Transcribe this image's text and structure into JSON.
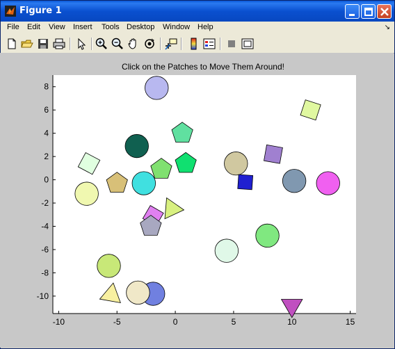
{
  "window": {
    "title": "Figure 1"
  },
  "menu": {
    "items": [
      "File",
      "Edit",
      "View",
      "Insert",
      "Tools",
      "Desktop",
      "Window",
      "Help"
    ]
  },
  "toolbar": {
    "tools": [
      "new-file",
      "open-file",
      "save",
      "print",
      "select-arrow",
      "zoom-in",
      "zoom-out",
      "pan",
      "rotate-3d",
      "data-cursor",
      "insert-colorbar",
      "insert-legend",
      "hide-plot-tools",
      "show-plot-tools"
    ]
  },
  "plot": {
    "title": "Click on the Patches to Move Them Around!"
  },
  "chart_data": {
    "type": "scatter",
    "title": "Click on the Patches to Move Them Around!",
    "xlim": [
      -10.5,
      15.5
    ],
    "ylim": [
      -11.5,
      9
    ],
    "xticks": [
      -10,
      -5,
      0,
      5,
      10,
      15
    ],
    "yticks": [
      -10,
      -8,
      -6,
      -4,
      -2,
      0,
      2,
      4,
      6,
      8
    ],
    "grid": false,
    "patches": [
      {
        "shape": "circle",
        "x": -1.6,
        "y": 7.9,
        "r": 1.0,
        "color": "#b8b8f0"
      },
      {
        "shape": "square",
        "x": 11.6,
        "y": 6.0,
        "r": 0.85,
        "angle": 18,
        "color": "#e0f8a0"
      },
      {
        "shape": "pentagon",
        "x": 0.6,
        "y": 4.0,
        "r": 0.95,
        "color": "#60e0a0"
      },
      {
        "shape": "circle",
        "x": -3.3,
        "y": 2.9,
        "r": 1.0,
        "color": "#106050"
      },
      {
        "shape": "square",
        "x": 8.4,
        "y": 2.2,
        "r": 0.85,
        "angle": 10,
        "color": "#a080d0"
      },
      {
        "shape": "square",
        "x": -7.4,
        "y": 1.4,
        "r": 0.85,
        "angle": 28,
        "color": "#e0ffe0"
      },
      {
        "shape": "pentagon",
        "x": 0.9,
        "y": 1.4,
        "r": 0.95,
        "color": "#10e070"
      },
      {
        "shape": "pentagon",
        "x": -1.2,
        "y": 0.9,
        "r": 0.95,
        "color": "#80e070"
      },
      {
        "shape": "circle",
        "x": 5.2,
        "y": 1.4,
        "r": 1.0,
        "color": "#d0c8a0"
      },
      {
        "shape": "pentagon",
        "x": -5.0,
        "y": -0.3,
        "r": 0.95,
        "color": "#d8c078"
      },
      {
        "shape": "circle",
        "x": -2.7,
        "y": -0.3,
        "r": 1.0,
        "color": "#40e0e0"
      },
      {
        "shape": "square",
        "x": 6.0,
        "y": -0.2,
        "r": 0.75,
        "angle": 4,
        "color": "#2020d0"
      },
      {
        "shape": "circle",
        "x": 10.2,
        "y": -0.1,
        "r": 1.0,
        "color": "#8098b0"
      },
      {
        "shape": "circle",
        "x": 13.1,
        "y": -0.3,
        "r": 1.0,
        "color": "#f060f0"
      },
      {
        "shape": "circle",
        "x": -7.6,
        "y": -1.2,
        "r": 1.0,
        "color": "#f0f8b0"
      },
      {
        "shape": "triangle",
        "x": -0.3,
        "y": -2.5,
        "r": 0.95,
        "angle": -25,
        "color": "#d8f080"
      },
      {
        "shape": "square",
        "x": -1.9,
        "y": -3.1,
        "r": 0.8,
        "angle": 30,
        "color": "#e080f0"
      },
      {
        "shape": "pentagon",
        "x": -2.1,
        "y": -4.0,
        "r": 0.95,
        "color": "#a8a8c0"
      },
      {
        "shape": "circle",
        "x": 7.9,
        "y": -4.8,
        "r": 1.0,
        "color": "#80e880"
      },
      {
        "shape": "circle",
        "x": 4.4,
        "y": -6.1,
        "r": 1.0,
        "color": "#e0f8e8"
      },
      {
        "shape": "circle",
        "x": -5.7,
        "y": -7.4,
        "r": 1.0,
        "color": "#c8e878"
      },
      {
        "shape": "circle",
        "x": -1.9,
        "y": -9.8,
        "r": 1.0,
        "color": "#7080e0"
      },
      {
        "shape": "circle",
        "x": -3.2,
        "y": -9.7,
        "r": 1.0,
        "color": "#f0e8c8"
      },
      {
        "shape": "triangle",
        "x": -5.5,
        "y": -9.9,
        "r": 0.95,
        "angle": 10,
        "color": "#f8f0a0"
      },
      {
        "shape": "triangle",
        "x": 10.0,
        "y": -10.8,
        "r": 0.95,
        "angle": 180,
        "color": "#c050c0"
      }
    ]
  }
}
